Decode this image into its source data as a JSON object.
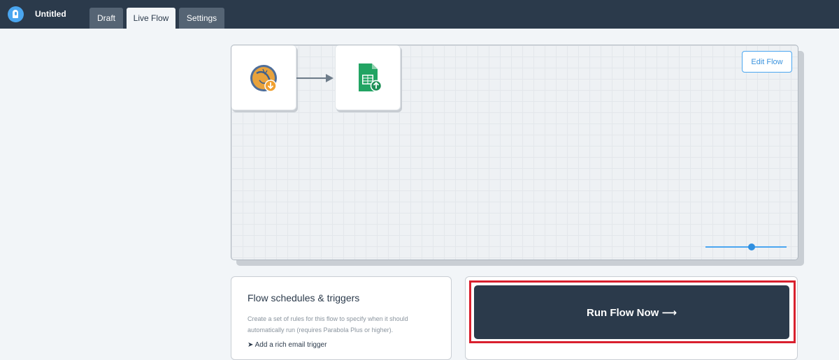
{
  "header": {
    "flow_title": "Untitled",
    "tabs": [
      {
        "label": "Draft",
        "active": false
      },
      {
        "label": "Live Flow",
        "active": true
      },
      {
        "label": "Settings",
        "active": false
      }
    ]
  },
  "canvas": {
    "edit_flow_label": "Edit Flow",
    "nodes": [
      {
        "icon": "mysql-icon"
      },
      {
        "icon": "google-sheets-export-icon"
      }
    ],
    "zoom_level": 0.57
  },
  "schedules": {
    "title": "Flow schedules & triggers",
    "description": "Create a set of rules for this flow to specify when it should automatically run (requires Parabola Plus or higher).",
    "add_link": "Add a rich email trigger"
  },
  "run": {
    "button_label": "Run Flow Now ⟶"
  },
  "colors": {
    "header_bg": "#2b3a4b",
    "accent": "#4aa6f0",
    "highlight": "#d9202e"
  }
}
